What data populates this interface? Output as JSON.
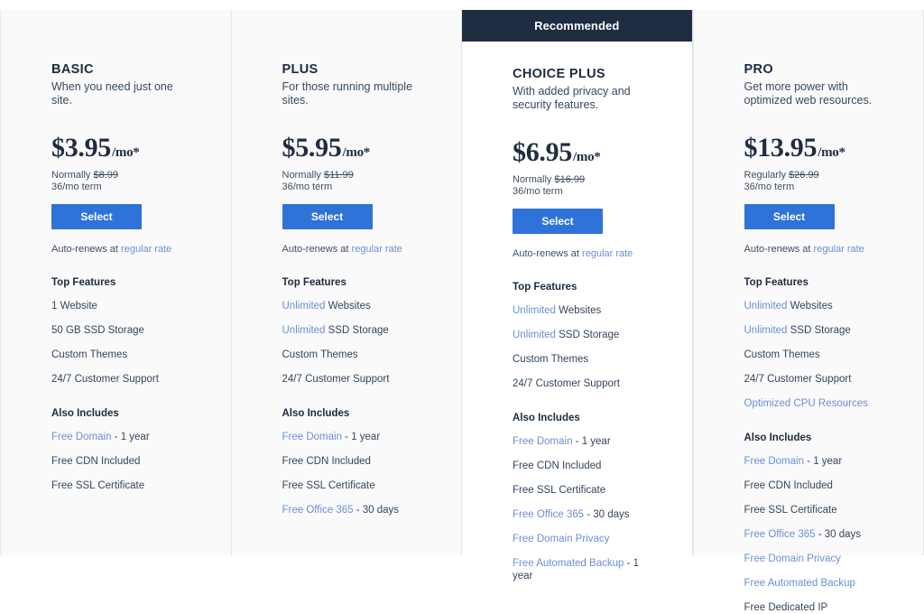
{
  "plans": [
    {
      "name": "BASIC",
      "tagline": "When you need just one site.",
      "recommended": false,
      "ribbon_label": "",
      "price": "$3.95",
      "price_period": "/mo*",
      "normally_prefix": "Normally",
      "normally_price": "$8.99",
      "term": "36/mo term",
      "select_label": "Select",
      "autorenew_text": "Auto-renews at",
      "autorenew_link": "regular rate",
      "top_features_heading": "Top Features",
      "top_features": [
        {
          "highlight": "",
          "text": "1 Website"
        },
        {
          "highlight": "",
          "text": "50 GB SSD Storage"
        },
        {
          "highlight": "",
          "text": "Custom Themes"
        },
        {
          "highlight": "",
          "text": "24/7 Customer Support"
        }
      ],
      "also_includes_heading": "Also Includes",
      "also_includes": [
        {
          "highlight": "Free Domain",
          "text": " - 1 year"
        },
        {
          "highlight": "",
          "text": "Free CDN Included"
        },
        {
          "highlight": "",
          "text": "Free SSL Certificate"
        }
      ]
    },
    {
      "name": "PLUS",
      "tagline": "For those running multiple sites.",
      "recommended": false,
      "ribbon_label": "",
      "price": "$5.95",
      "price_period": "/mo*",
      "normally_prefix": "Normally",
      "normally_price": "$11.99",
      "term": "36/mo term",
      "select_label": "Select",
      "autorenew_text": "Auto-renews at",
      "autorenew_link": "regular rate",
      "top_features_heading": "Top Features",
      "top_features": [
        {
          "highlight": "Unlimited",
          "text": " Websites"
        },
        {
          "highlight": "Unlimited",
          "text": " SSD Storage"
        },
        {
          "highlight": "",
          "text": "Custom Themes"
        },
        {
          "highlight": "",
          "text": "24/7 Customer Support"
        }
      ],
      "also_includes_heading": "Also Includes",
      "also_includes": [
        {
          "highlight": "Free Domain",
          "text": " - 1 year"
        },
        {
          "highlight": "",
          "text": "Free CDN Included"
        },
        {
          "highlight": "",
          "text": "Free SSL Certificate"
        },
        {
          "highlight": "Free Office 365",
          "text": " - 30 days"
        }
      ]
    },
    {
      "name": "CHOICE PLUS",
      "tagline": "With added privacy and security features.",
      "recommended": true,
      "ribbon_label": "Recommended",
      "price": "$6.95",
      "price_period": "/mo*",
      "normally_prefix": "Normally",
      "normally_price": "$16.99",
      "term": "36/mo term",
      "select_label": "Select",
      "autorenew_text": "Auto-renews at",
      "autorenew_link": "regular rate",
      "top_features_heading": "Top Features",
      "top_features": [
        {
          "highlight": "Unlimited",
          "text": " Websites"
        },
        {
          "highlight": "Unlimited",
          "text": " SSD Storage"
        },
        {
          "highlight": "",
          "text": "Custom Themes"
        },
        {
          "highlight": "",
          "text": "24/7 Customer Support"
        }
      ],
      "also_includes_heading": "Also Includes",
      "also_includes": [
        {
          "highlight": "Free Domain",
          "text": " - 1 year"
        },
        {
          "highlight": "",
          "text": "Free CDN Included"
        },
        {
          "highlight": "",
          "text": "Free SSL Certificate"
        },
        {
          "highlight": "Free Office 365",
          "text": " - 30 days"
        },
        {
          "highlight": "Free Domain Privacy",
          "text": ""
        },
        {
          "highlight": "Free Automated Backup",
          "text": " - 1 year"
        }
      ]
    },
    {
      "name": "PRO",
      "tagline": "Get more power with optimized web resources.",
      "recommended": false,
      "ribbon_label": "",
      "price": "$13.95",
      "price_period": "/mo*",
      "normally_prefix": "Regularly",
      "normally_price": "$26.99",
      "term": "36/mo term",
      "select_label": "Select",
      "autorenew_text": "Auto-renews at",
      "autorenew_link": "regular rate",
      "top_features_heading": "Top Features",
      "top_features": [
        {
          "highlight": "Unlimited",
          "text": " Websites"
        },
        {
          "highlight": "Unlimited",
          "text": " SSD Storage"
        },
        {
          "highlight": "",
          "text": "Custom Themes"
        },
        {
          "highlight": "",
          "text": "24/7 Customer Support"
        },
        {
          "highlight": "Optimized CPU Resources",
          "text": ""
        }
      ],
      "also_includes_heading": "Also Includes",
      "also_includes": [
        {
          "highlight": "Free Domain",
          "text": " - 1 year"
        },
        {
          "highlight": "",
          "text": "Free CDN Included"
        },
        {
          "highlight": "",
          "text": "Free SSL Certificate"
        },
        {
          "highlight": "Free Office 365",
          "text": " - 30 days"
        },
        {
          "highlight": "Free Domain Privacy",
          "text": ""
        },
        {
          "highlight": "Free Automated Backup",
          "text": ""
        },
        {
          "highlight": "",
          "text": "Free Dedicated IP"
        }
      ]
    }
  ],
  "colors": {
    "accent_blue": "#2f72d8",
    "link_blue": "#6b8fd4",
    "ribbon_navy": "#1f2d42",
    "card_bg": "#fafafa",
    "recommended_card_bg": "#ffffff"
  }
}
